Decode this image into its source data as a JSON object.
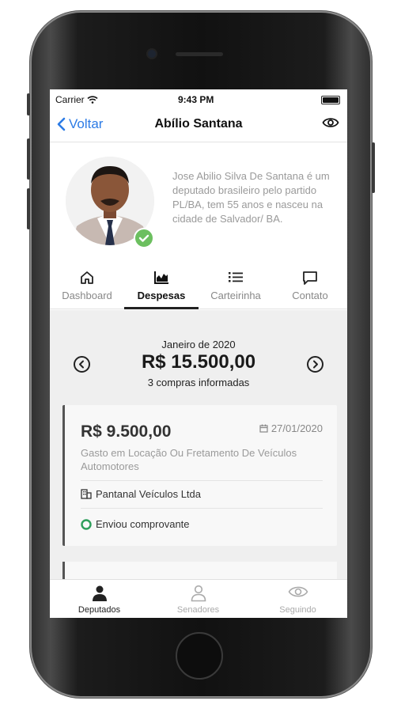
{
  "status_bar": {
    "carrier": "Carrier",
    "time": "9:43 PM"
  },
  "navbar": {
    "back_label": "Voltar",
    "title": "Abílio Santana"
  },
  "profile": {
    "bio": "Jose Abilio Silva De Santana é um deputado brasileiro pelo partido PL/BA, tem 55 anos e nasceu na cidade de Salvador/ BA."
  },
  "tabs": [
    {
      "label": "Dashboard",
      "icon": "home-icon"
    },
    {
      "label": "Despesas",
      "icon": "chart-icon"
    },
    {
      "label": "Carteirinha",
      "icon": "list-icon"
    },
    {
      "label": "Contato",
      "icon": "message-icon"
    }
  ],
  "summary": {
    "period": "Janeiro de 2020",
    "total": "R$ 15.500,00",
    "count": "3 compras informadas"
  },
  "expense": {
    "amount": "R$ 9.500,00",
    "date": "27/01/2020",
    "description": "Gasto em Locação Ou Fretamento De Veículos Automotores",
    "company": "Pantanal Veículos Ltda",
    "status": "Enviou comprovante"
  },
  "bottom_tabs": [
    {
      "label": "Deputados",
      "icon": "person-icon"
    },
    {
      "label": "Senadores",
      "icon": "person-outline-icon"
    },
    {
      "label": "Seguindo",
      "icon": "eye-icon"
    }
  ],
  "colors": {
    "accent": "#2c7be5",
    "verified": "#6cbf5f",
    "status_ok": "#2e9e5b"
  }
}
